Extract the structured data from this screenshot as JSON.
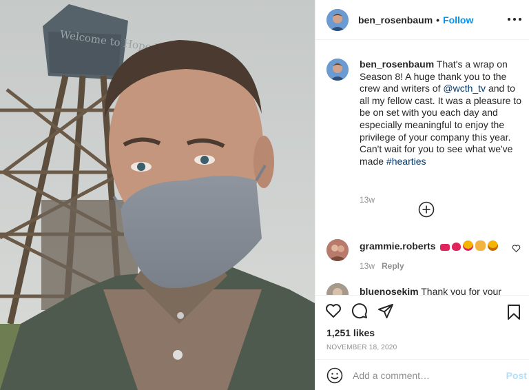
{
  "photo": {
    "sign_text": "Welcome to Hope Valley"
  },
  "post": {
    "username": "ben_rosenbaum",
    "follow_label": "Follow",
    "caption_before_mention": "That's a wrap on Season 8! A huge thank you to the crew and writers of ",
    "mention": "@wcth_tv",
    "caption_after_mention": " and to all my fellow cast. It was a pleasure to be on set with you each day and especially meaningful to enjoy the privilege of your company this year. Can't wait for you to see what we've made ",
    "hashtag": "#hearties",
    "caption_time": "13w"
  },
  "comments": [
    {
      "username": "grammie.roberts",
      "time": "13w",
      "reply_label": "Reply"
    },
    {
      "username": "bluenosekim",
      "text": "Thank you for your"
    }
  ],
  "footer": {
    "likes": "1,251 likes",
    "date": "NOVEMBER 18, 2020",
    "add_comment_placeholder": "Add a comment…",
    "post_label": "Post"
  },
  "colors": {
    "accent": "#0095f6",
    "link": "#00376b",
    "muted": "#8e8e8e",
    "post_disabled": "#b2dffc"
  },
  "icons": [
    "more-icon",
    "add-comments-icon",
    "heart-icon",
    "comment-icon",
    "share-icon",
    "save-icon",
    "emoji-icon",
    "like-comment-icon"
  ]
}
